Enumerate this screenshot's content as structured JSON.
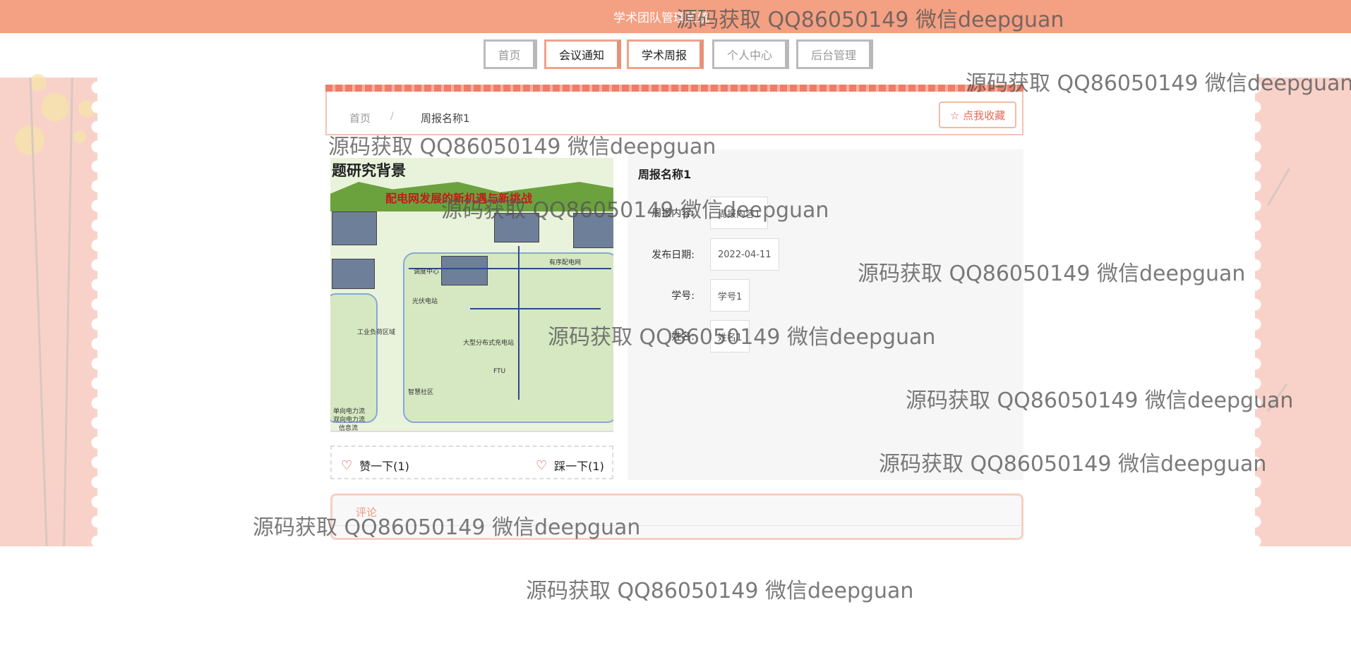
{
  "header": {
    "site_title": "学术团队管理系统"
  },
  "nav": {
    "items": [
      {
        "label": "首页"
      },
      {
        "label": "会议通知"
      },
      {
        "label": "学术周报"
      },
      {
        "label": "个人中心"
      },
      {
        "label": "后台管理"
      }
    ]
  },
  "breadcrumb": {
    "home": "首页",
    "separator": "/",
    "current": "周报名称1",
    "favorite_button": "☆ 点我收藏"
  },
  "report_image": {
    "title": "题研究背景",
    "banner_text": "配电网发展的新机遇与新挑战",
    "labels": [
      "调度中心",
      "光伏电站",
      "有序配电网",
      "工业负荷区域",
      "大型分布式充电站",
      "FTU",
      "智慧社区",
      "单向电力流",
      "双向电力流",
      "信息流"
    ]
  },
  "votes": {
    "like": "赞一下(1)",
    "dislike": "踩一下(1)"
  },
  "details": {
    "title": "周报名称1",
    "fields": [
      {
        "label": "周报内容:",
        "value": "周报内容1"
      },
      {
        "label": "发布日期:",
        "value": "2022-04-11"
      },
      {
        "label": "学号:",
        "value": "学号1"
      },
      {
        "label": "姓名:",
        "value": "姓名1"
      }
    ]
  },
  "comments": {
    "tab": "评论"
  },
  "watermarks": [
    "源码获取 QQ86050149 微信deepguan",
    "源码获取 QQ86050149 微信deepguan",
    "源码获取 QQ86050149 微信deepguan",
    "源码获取 QQ86050149 微信deepguan",
    "源码获取 QQ86050149 微信deepguan",
    "源码获取 QQ86050149 微信deepguan",
    "源码获取 QQ86050149 微信deepguan",
    "源码获取 QQ86050149 微信deepguan",
    "源码获取 QQ86050149 微信deepguan",
    "源码获取 QQ86050149 微信deepguan"
  ]
}
